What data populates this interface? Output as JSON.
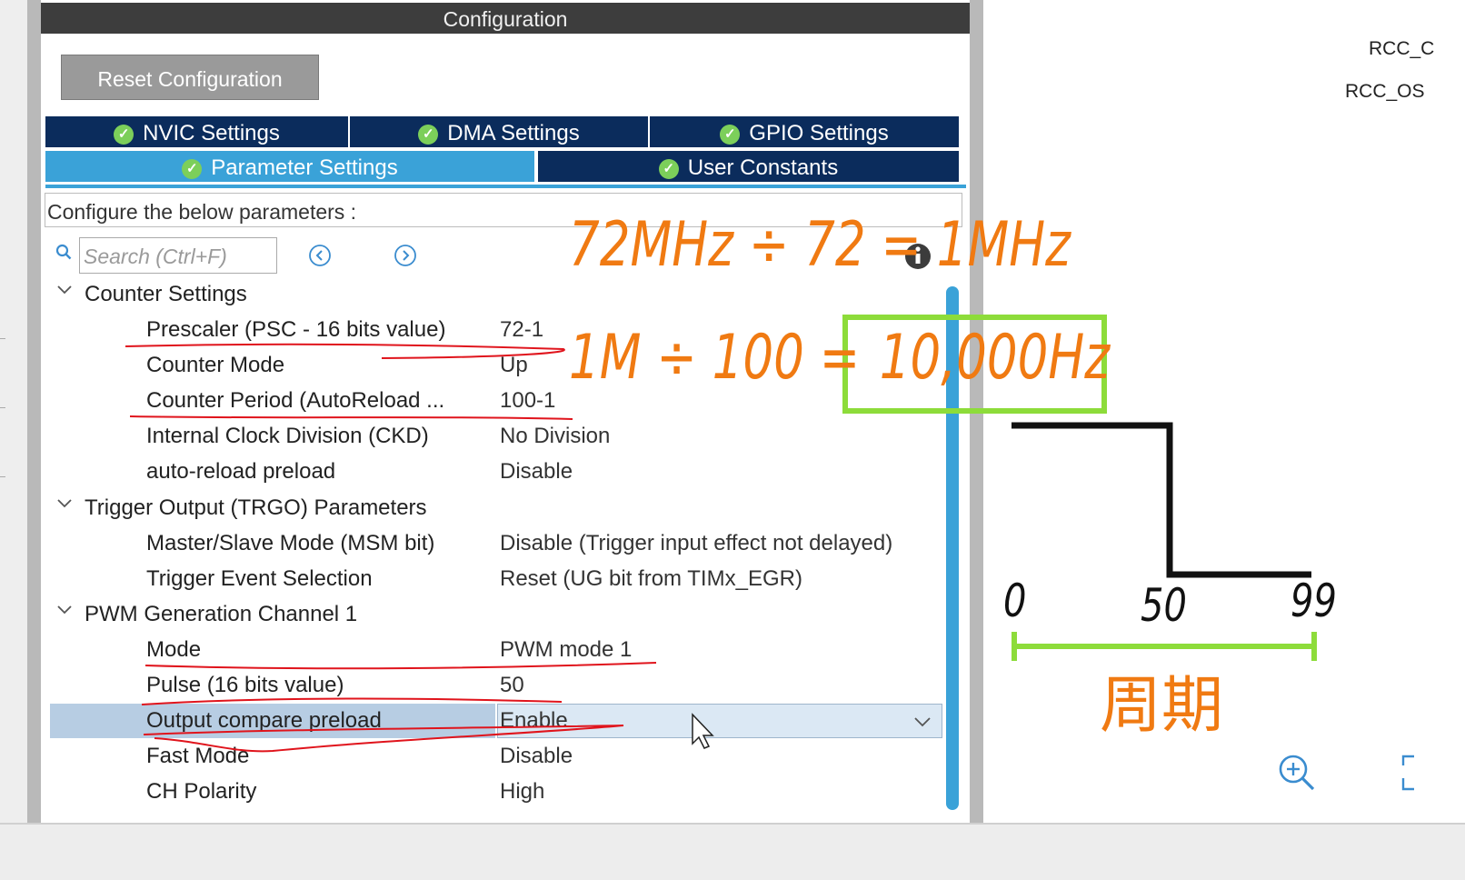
{
  "panel": {
    "title": "Configuration",
    "reset_button": "Reset Configuration",
    "tabs_row1": [
      "NVIC Settings",
      "DMA Settings",
      "GPIO Settings"
    ],
    "tabs_row2": [
      "Parameter Settings",
      "User Constants"
    ],
    "configure_label": "Configure the below parameters :",
    "search_placeholder": "Search (Ctrl+F)"
  },
  "groups": [
    {
      "title": "Counter Settings",
      "params": [
        {
          "name": "Prescaler (PSC - 16 bits value)",
          "value": "72-1"
        },
        {
          "name": "Counter Mode",
          "value": "Up"
        },
        {
          "name": "Counter Period (AutoReload ...",
          "value": "100-1"
        },
        {
          "name": "Internal Clock Division (CKD)",
          "value": "No Division"
        },
        {
          "name": "auto-reload preload",
          "value": "Disable"
        }
      ]
    },
    {
      "title": "Trigger Output (TRGO) Parameters",
      "params": [
        {
          "name": "Master/Slave Mode (MSM bit)",
          "value": "Disable (Trigger input effect not delayed)"
        },
        {
          "name": "Trigger Event Selection",
          "value": "Reset (UG bit from TIMx_EGR)"
        }
      ]
    },
    {
      "title": "PWM Generation Channel 1",
      "params": [
        {
          "name": "Mode",
          "value": "PWM mode 1"
        },
        {
          "name": "Pulse (16 bits value)",
          "value": "50"
        },
        {
          "name": "Output compare preload",
          "value": "Enable"
        },
        {
          "name": "Fast Mode",
          "value": "Disable"
        },
        {
          "name": "CH Polarity",
          "value": "High"
        }
      ]
    }
  ],
  "right": {
    "labels": [
      "RCC_C",
      "RCC_OS"
    ]
  },
  "annotations": {
    "line1": "72MHz ÷ 72 = 1MHz",
    "line2_prefix": "1M ÷ 100 = ",
    "line2_boxed": "10,000Hz",
    "axis_0": "0",
    "axis_50": "50",
    "axis_99": "99",
    "period": "周期"
  },
  "colors": {
    "tab_dark": "#0b2c5c",
    "tab_active": "#3aa2d8",
    "annotation_orange": "#f07a12",
    "annotation_green": "#8ddc3a",
    "underline_red": "#e0141c"
  }
}
